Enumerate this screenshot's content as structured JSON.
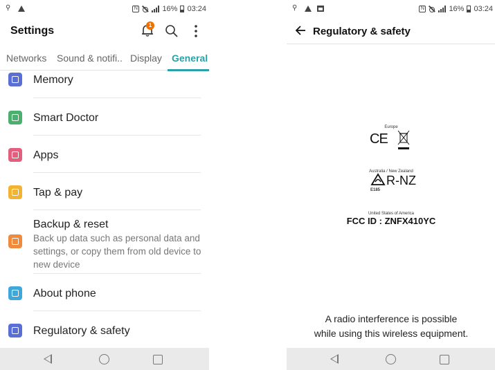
{
  "left": {
    "status": {
      "battery": "16%",
      "time": "03:24"
    },
    "header": {
      "title": "Settings",
      "notification_count": "1",
      "icons": [
        "bell-icon",
        "search-icon",
        "more-vert-icon"
      ]
    },
    "tabs": [
      {
        "label": "Networks",
        "active": false
      },
      {
        "label": "Sound & notifi..",
        "active": false
      },
      {
        "label": "Display",
        "active": false
      },
      {
        "label": "General",
        "active": true
      }
    ],
    "items": [
      {
        "label": "Memory",
        "icon": "memory-icon",
        "color": "#5a6fd6"
      },
      {
        "label": "Smart Doctor",
        "icon": "smart-doctor-icon",
        "color": "#4caf6e"
      },
      {
        "label": "Apps",
        "icon": "apps-icon",
        "color": "#e0607e"
      },
      {
        "label": "Tap & pay",
        "icon": "tap-pay-icon",
        "color": "#f2b233"
      },
      {
        "label": "Backup & reset",
        "icon": "backup-icon",
        "color": "#f08a3c",
        "sub": "Back up data such as personal data and settings, or copy them from old device to new device"
      },
      {
        "label": "About phone",
        "icon": "info-icon",
        "color": "#3fa8d8"
      },
      {
        "label": "Regulatory & safety",
        "icon": "regulatory-icon",
        "color": "#5a6fd6"
      }
    ]
  },
  "right": {
    "status": {
      "battery": "16%",
      "time": "03:24"
    },
    "header": {
      "title": "Regulatory & safety"
    },
    "regulatory": {
      "europe_label": "Europe",
      "ce_mark": "CE",
      "anz_label": "Australia / New Zealand",
      "rcm_mark": "R-NZ",
      "rcm_code": "E185",
      "us_label": "United States of America",
      "fcc_id": "FCC ID : ZNFX410YC"
    },
    "warning_line1": "A radio interference is possible",
    "warning_line2": "while using this wireless equipment."
  }
}
